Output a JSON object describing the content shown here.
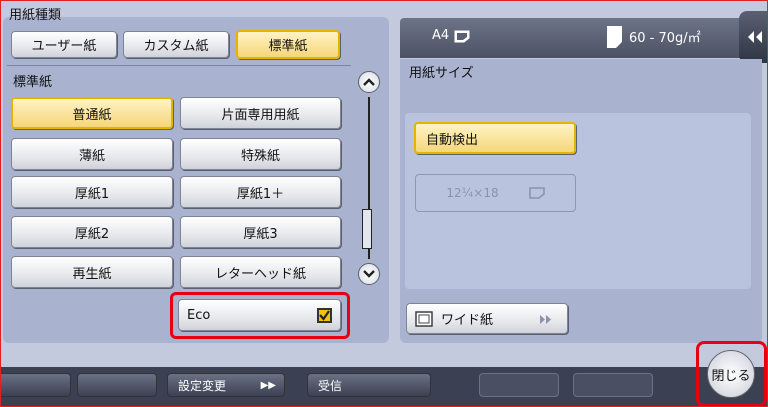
{
  "paper_type": {
    "title": "用紙種類",
    "tabs": [
      {
        "label": "ユーザー紙"
      },
      {
        "label": "カスタム紙"
      },
      {
        "label": "標準紙"
      }
    ],
    "list_label": "標準紙",
    "options": [
      {
        "label": "普通紙"
      },
      {
        "label": "片面専用用紙"
      },
      {
        "label": "薄紙"
      },
      {
        "label": "特殊紙"
      },
      {
        "label": "厚紙1"
      },
      {
        "label": "厚紙1＋"
      },
      {
        "label": "厚紙2"
      },
      {
        "label": "厚紙3"
      },
      {
        "label": "再生紙"
      },
      {
        "label": "レターヘッド紙"
      }
    ],
    "eco_label": "Eco"
  },
  "info_bar": {
    "size": "A4",
    "weight": "60 - 70g/㎡"
  },
  "paper_size": {
    "title": "用紙サイズ",
    "auto_detect": "自動検出",
    "custom_size": "12¼×18",
    "wide_label": "ワイド紙"
  },
  "bottom_bar": {
    "settings_change": "設定変更",
    "recv": "受信"
  },
  "close_label": "閉じる",
  "colors": {
    "highlight": "#e60012",
    "selected_fill": "#f5d77a",
    "panel": "#a9b3cf"
  }
}
